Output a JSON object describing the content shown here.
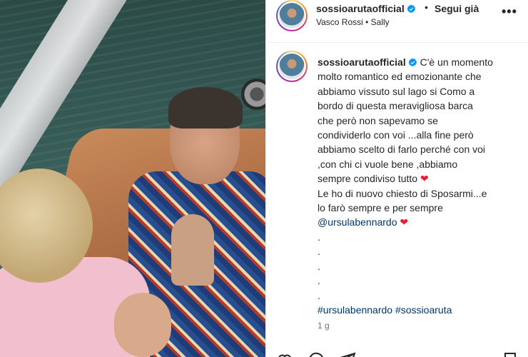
{
  "post": {
    "username": "sossioarutaofficial",
    "separator": "•",
    "follow_label": "Segui già",
    "music": "Vasco Rossi • Sally",
    "more_label": "•••"
  },
  "caption": {
    "username": "sossioarutaofficial",
    "lines": [
      "C'è un momento",
      "molto romantico ed emozionante che",
      "abbiamo vissuto sul lago si Como a",
      "bordo di questa meravigliosa barca",
      "che però non sapevamo se",
      "condividerlo con voi ...alla fine però",
      "abbiamo scelto di farlo perché con voi",
      ",con chi ci vuole bene ,abbiamo",
      "sempre condiviso tutto",
      "Le ho di nuovo chiesto di Sposarmi...e",
      "lo farò sempre e per sempre"
    ],
    "mention": "@ursulabennardo",
    "dots": [
      ".",
      ".",
      ".",
      ".",
      "."
    ],
    "hashtags": [
      "#ursulabennardo",
      "#sossioaruta"
    ],
    "heart": "❤",
    "age": "1 g"
  },
  "colors": {
    "link": "#00376b",
    "heart": "#ed1c2e",
    "verified": "#0095f6",
    "muted": "#737373"
  },
  "icons": [
    "verified-badge-icon",
    "heart-icon",
    "comment-icon",
    "share-icon",
    "save-icon",
    "more-options-icon"
  ]
}
